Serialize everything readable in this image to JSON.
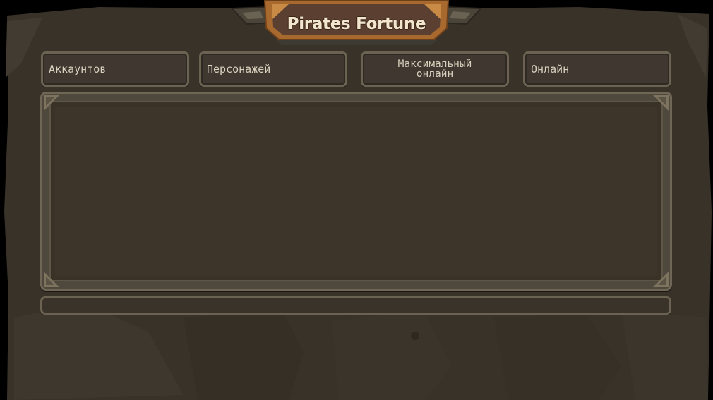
{
  "title": "Pirates Fortune",
  "stats": {
    "accounts_label": "Аккаунтов",
    "characters_label": "Персонажей",
    "max_online_label": "Максимальный\nонлайн",
    "online_label": "Онлайн"
  },
  "progress": {
    "fraction": 0
  },
  "colors": {
    "panel": "#4f483c",
    "panel_inner": "#3d3529",
    "border": "#6f6655",
    "banner": "#a8692f",
    "banner_inner": "#5b4032",
    "text": "#d9d0be"
  },
  "icons": {
    "banner_ornament": "wing-ornament-icon",
    "corner": "corner-ornament-icon"
  }
}
